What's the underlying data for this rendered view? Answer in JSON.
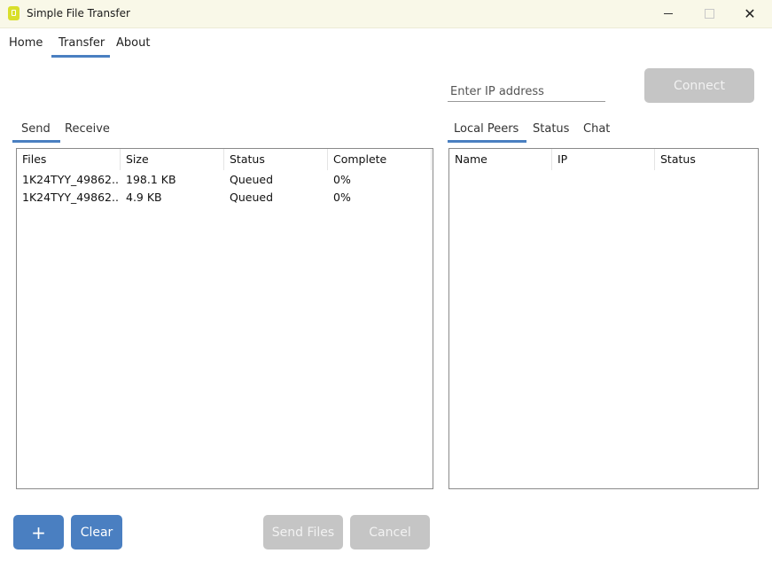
{
  "window": {
    "title": "Simple File Transfer",
    "minimize_icon": "minimize-icon",
    "maximize_icon": "maximize-icon",
    "close_icon": "close-icon",
    "close_glyph": "✕"
  },
  "nav": {
    "items": [
      {
        "label": "Home"
      },
      {
        "label": "Transfer"
      },
      {
        "label": "About"
      }
    ],
    "active": "Transfer",
    "accent": "#4a7fc1"
  },
  "connect": {
    "ip_placeholder": "Enter IP address",
    "connect_label": "Connect"
  },
  "send_panel": {
    "tabs": [
      {
        "label": "Send"
      },
      {
        "label": "Receive"
      }
    ],
    "active_tab": "Send",
    "columns": [
      "Files",
      "Size",
      "Status",
      "Complete"
    ],
    "rows": [
      {
        "file": "1K24TYY_49862...",
        "size": "198.1 KB",
        "status": "Queued",
        "complete": "0%"
      },
      {
        "file": "1K24TYY_49862...",
        "size": "4.9 KB",
        "status": "Queued",
        "complete": "0%"
      }
    ]
  },
  "peers_panel": {
    "tabs": [
      {
        "label": "Local Peers"
      },
      {
        "label": "Status"
      },
      {
        "label": "Chat"
      }
    ],
    "active_tab": "Local Peers",
    "columns": [
      "Name",
      "IP",
      "Status"
    ]
  },
  "bottom": {
    "add_label": "+",
    "clear_label": "Clear",
    "send_files_label": "Send Files",
    "cancel_label": "Cancel"
  }
}
